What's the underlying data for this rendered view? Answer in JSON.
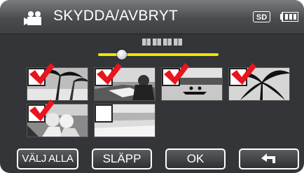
{
  "header": {
    "title": "SKYDDA/AVBRYT",
    "storage_badge": "SD",
    "icons": [
      "video-camera-icon",
      "battery-icon"
    ]
  },
  "scroll": {
    "position_fraction": 0.2
  },
  "thumbnails": [
    {
      "scene": "palm-trees-beach",
      "checked": true
    },
    {
      "scene": "person-reading",
      "checked": true
    },
    {
      "scene": "canoe-on-lake",
      "checked": true
    },
    {
      "scene": "palm-silhouette",
      "checked": true
    },
    {
      "scene": "couple-portrait",
      "checked": true
    },
    {
      "scene": "beach-shoreline",
      "checked": false
    }
  ],
  "buttons": {
    "select_all": "VÄLJ ALLA",
    "release": "SLÄPP",
    "ok": "OK",
    "back_icon": "return-arrow-icon"
  },
  "colors": {
    "accent": "#f2e400",
    "check": "#e8141e",
    "header": "#5a5c60",
    "background": "#333538"
  }
}
